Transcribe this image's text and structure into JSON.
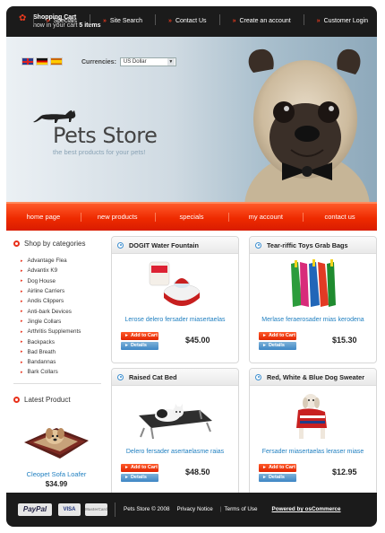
{
  "header": {
    "cart_title": "Shopping Cart",
    "cart_prefix": "now in your cart",
    "cart_count": "5 items",
    "nav": [
      "Specials",
      "Site Search",
      "Contact Us",
      "Create an account",
      "Customer Login"
    ]
  },
  "hero": {
    "currencies_label": "Currencies:",
    "currency_value": "US Dollar",
    "store_name": "Pets Store",
    "tagline": "the best products for your pets!"
  },
  "main_nav": [
    "home page",
    "new products",
    "specials",
    "my account",
    "contact us"
  ],
  "sidebar": {
    "categories_title": "Shop by categories",
    "categories": [
      "Advantage Flea",
      "Advantix K9",
      "Dog House",
      "Airline Carriers",
      "Andis Clippers",
      "Anti-bark Devices",
      "Jingle Collars",
      "Arthritis Supplements",
      "Backpacks",
      "Bad Breath",
      "Bandannas",
      "Bark Collars"
    ],
    "latest_title": "Latest Product",
    "latest_name": "Cleopet Sofa Loafer",
    "latest_price": "$34.99"
  },
  "buttons": {
    "add": "Add to Cart",
    "details": "Details"
  },
  "products": [
    {
      "title": "DOGIT Water Fountain",
      "desc": "Lerose delero fersader miasertaelas",
      "price": "$45.00"
    },
    {
      "title": "Tear-riffic Toys Grab Bags",
      "desc": "Merlase feraerosader mias kerodena",
      "price": "$15.30"
    },
    {
      "title": "Raised Cat Bed",
      "desc": "Delero fersader asertaelasme raias",
      "price": "$48.50"
    },
    {
      "title": "Red, White & Blue Dog Sweater",
      "desc": "Fersader miasertaelas leraser miase",
      "price": "$12.95"
    }
  ],
  "footer": {
    "payments": [
      "PayPal",
      "VISA",
      "MasterCard"
    ],
    "copyright": "Pets Store © 2008",
    "privacy": "Privacy Notice",
    "terms": "Terms of Use",
    "powered": "Powered by osCommerce"
  },
  "colors": {
    "accent": "#e83a1e",
    "link": "#1f7fc0",
    "dark": "#1b1b1b"
  }
}
